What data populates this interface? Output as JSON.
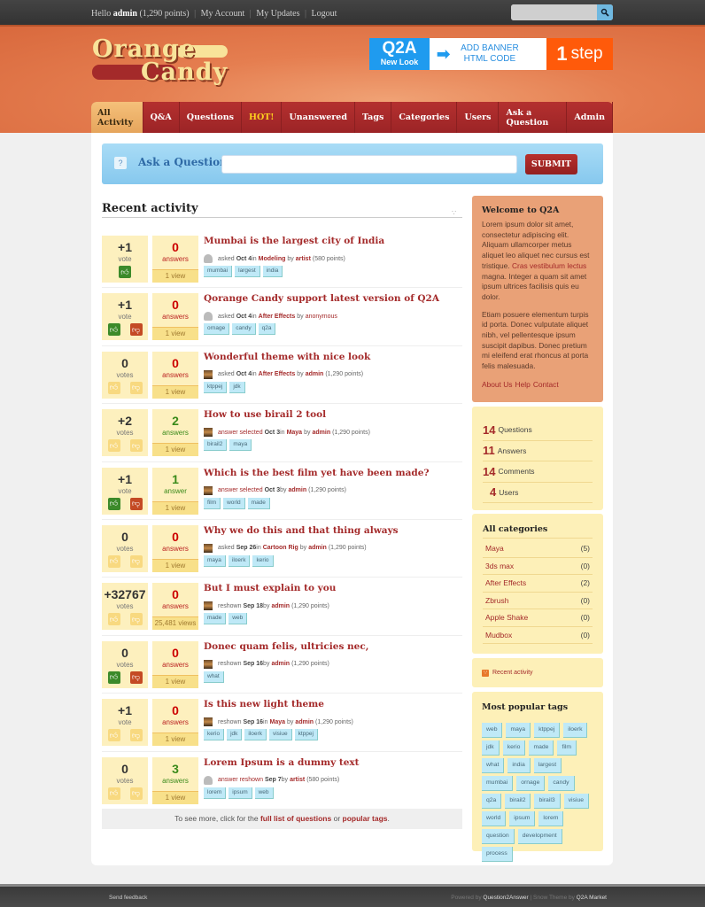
{
  "topbar": {
    "greeting": "Hello",
    "username": "admin",
    "points": "(1,290 points)",
    "links": [
      "My Account",
      "My Updates",
      "Logout"
    ],
    "search_placeholder": ""
  },
  "logo": {
    "line1": "Orange",
    "line2": "Candy"
  },
  "banner": {
    "brand": "Q2A",
    "sub": "New Look",
    "cta_line1": "ADD BANNER",
    "cta_line2": "HTML CODE",
    "step_num": "1",
    "step_label": "step"
  },
  "nav": {
    "tabs": [
      {
        "label": "All Activity",
        "active": true
      },
      {
        "label": "Q&A"
      },
      {
        "label": "Questions"
      },
      {
        "label": "HOT!",
        "hot": true
      },
      {
        "label": "Unanswered"
      },
      {
        "label": "Tags"
      },
      {
        "label": "Categories"
      },
      {
        "label": "Users"
      },
      {
        "label": "Ask a Question"
      },
      {
        "label": "Admin"
      }
    ]
  },
  "ask": {
    "label": "Ask a Question",
    "input_value": "",
    "submit": "SUBMIT"
  },
  "recent": {
    "title": "Recent activity",
    "questions": [
      {
        "votes": "+1",
        "votes_label": "vote",
        "answers": "0",
        "answers_label": "answers",
        "views": "1 view",
        "title": "Mumbai is the largest city of India",
        "avatar": "person",
        "what": "asked",
        "when": "Oct 4",
        "in": "in",
        "category": "Modeling",
        "by": "by",
        "who": "artist",
        "who_points": "(580 points)",
        "tags": [
          "mumbai",
          "largest",
          "india"
        ],
        "up_on": true,
        "down_on": false,
        "show_down": false,
        "answers_green": false
      },
      {
        "votes": "+1",
        "votes_label": "vote",
        "answers": "0",
        "answers_label": "answers",
        "views": "1 view",
        "title": "Qorange Candy support latest version of Q2A",
        "avatar": "person",
        "what": "asked",
        "when": "Oct 4",
        "in": "in",
        "category": "After Effects",
        "by": "by",
        "who": "anonymous",
        "who_points": "",
        "tags": [
          "ornage",
          "candy",
          "q2a"
        ],
        "up_on": true,
        "down_on": true,
        "show_down": true,
        "answers_green": false
      },
      {
        "votes": "0",
        "votes_label": "votes",
        "answers": "0",
        "answers_label": "answers",
        "views": "1 view",
        "title": "Wonderful theme with nice look",
        "avatar": "photo",
        "what": "asked",
        "when": "Oct 4",
        "in": "in",
        "category": "After Effects",
        "by": "by",
        "who": "admin",
        "who_points": "(1,290 points)",
        "tags": [
          "ktppej",
          "jdk"
        ],
        "up_on": false,
        "down_on": false,
        "show_down": true,
        "answers_green": false
      },
      {
        "votes": "+2",
        "votes_label": "votes",
        "answers": "2",
        "answers_label": "answers",
        "views": "1 view",
        "title": "How to use birail 2 tool",
        "avatar": "photo",
        "what": "answer selected",
        "when": "Oct 3",
        "in": "in",
        "category": "Maya",
        "by": "by",
        "who": "admin",
        "who_points": "(1,290 points)",
        "tags": [
          "birail2",
          "maya"
        ],
        "up_on": false,
        "down_on": false,
        "show_down": true,
        "answers_green": true
      },
      {
        "votes": "+1",
        "votes_label": "vote",
        "answers": "1",
        "answers_label": "answer",
        "views": "1 view",
        "title": "Which is the best film yet have been made?",
        "avatar": "photo",
        "what": "answer selected",
        "when": "Oct 3",
        "in": "",
        "category": "",
        "by": "by",
        "who": "admin",
        "who_points": "(1,290 points)",
        "tags": [
          "film",
          "world",
          "made"
        ],
        "up_on": true,
        "down_on": true,
        "show_down": true,
        "answers_green": true
      },
      {
        "votes": "0",
        "votes_label": "votes",
        "answers": "0",
        "answers_label": "answers",
        "views": "1 view",
        "title": "Why we do this and that thing always",
        "avatar": "photo",
        "what": "asked",
        "when": "Sep 26",
        "in": "in",
        "category": "Cartoon Rig",
        "by": "by",
        "who": "admin",
        "who_points": "(1,290 points)",
        "tags": [
          "maya",
          "iloerk",
          "kerio"
        ],
        "up_on": false,
        "down_on": false,
        "show_down": true,
        "answers_green": false
      },
      {
        "votes": "+32767",
        "votes_label": "votes",
        "answers": "0",
        "answers_label": "answers",
        "views": "25,481 views",
        "title": "But I must explain to you",
        "avatar": "photo",
        "what": "reshown",
        "when": "Sep 18",
        "in": "",
        "category": "",
        "by": "by",
        "who": "admin",
        "who_points": "(1,290 points)",
        "tags": [
          "made",
          "web"
        ],
        "up_on": false,
        "down_on": false,
        "show_down": true,
        "answers_green": false
      },
      {
        "votes": "0",
        "votes_label": "votes",
        "answers": "0",
        "answers_label": "answers",
        "views": "1 view",
        "title": "Donec quam felis, ultricies nec,",
        "avatar": "photo",
        "what": "reshown",
        "when": "Sep 16",
        "in": "",
        "category": "",
        "by": "by",
        "who": "admin",
        "who_points": "(1,290 points)",
        "tags": [
          "what"
        ],
        "up_on": true,
        "down_on": true,
        "show_down": true,
        "answers_green": false
      },
      {
        "votes": "+1",
        "votes_label": "vote",
        "answers": "0",
        "answers_label": "answers",
        "views": "1 view",
        "title": "Is this new light theme",
        "avatar": "photo",
        "what": "reshown",
        "when": "Sep 16",
        "in": "in",
        "category": "Maya",
        "by": "by",
        "who": "admin",
        "who_points": "(1,290 points)",
        "tags": [
          "kerio",
          "jdk",
          "iloerk",
          "visiue",
          "ktppej"
        ],
        "up_on": false,
        "down_on": false,
        "show_down": true,
        "answers_green": false
      },
      {
        "votes": "0",
        "votes_label": "votes",
        "answers": "3",
        "answers_label": "answers",
        "views": "1 view",
        "title": "Lorem Ipsum is a dummy text",
        "avatar": "person",
        "what": "answer reshown",
        "when": "Sep 7",
        "in": "",
        "category": "",
        "by": "by",
        "who": "artist",
        "who_points": "(580 points)",
        "tags": [
          "lorem",
          "ipsum",
          "web"
        ],
        "up_on": false,
        "down_on": false,
        "show_down": true,
        "answers_green": true
      }
    ],
    "more_prefix": "To see more, click for the",
    "more_link1": "full list of questions",
    "more_mid": "or",
    "more_link2": "popular tags",
    "more_suffix": "."
  },
  "sidebar": {
    "welcome": {
      "title": "Welcome to Q2A",
      "p1_a": "Lorem ipsum dolor sit amet, consectetur adipiscing elit. Aliquam ullamcorper metus aliquet leo aliquet nec cursus est tristique.",
      "p1_link": "Cras vestibulum lectus",
      "p1_b": "magna. Integer a quam sit amet ipsum ultrices facilisis quis eu dolor.",
      "p2": "Etiam posuere elementum turpis id porta. Donec vulputate aliquet nibh, vel pellentesque ipsum suscipit dapibus. Donec pretium mi eleifend erat rhoncus at porta felis malesuada.",
      "links": [
        "About Us",
        "Help",
        "Contact"
      ]
    },
    "stats": [
      {
        "count": "14",
        "label": "Questions"
      },
      {
        "count": "11",
        "label": "Answers"
      },
      {
        "count": "14",
        "label": "Comments"
      },
      {
        "count": "4",
        "label": "Users"
      }
    ],
    "categories": {
      "title": "All categories",
      "items": [
        {
          "name": "Maya",
          "count": "(5)"
        },
        {
          "name": "3ds max",
          "count": "(0)"
        },
        {
          "name": "After Effects",
          "count": "(2)"
        },
        {
          "name": "Zbrush",
          "count": "(0)"
        },
        {
          "name": "Apple Shake",
          "count": "(0)"
        },
        {
          "name": "Mudbox",
          "count": "(0)"
        }
      ]
    },
    "feed": {
      "label": "Recent activity"
    },
    "popular_tags": {
      "title": "Most popular tags",
      "tags": [
        "web",
        "maya",
        "ktppej",
        "iloerk",
        "jdk",
        "kerio",
        "made",
        "film",
        "what",
        "india",
        "largest",
        "mumbai",
        "ornage",
        "candy",
        "q2a",
        "birail2",
        "birail3",
        "visiue",
        "world",
        "ipsum",
        "lorem",
        "question",
        "development",
        "process"
      ]
    }
  },
  "footer": {
    "feedback": "Send feedback",
    "powered_prefix": "Powered by",
    "powered_link": "Question2Answer",
    "theme_prefix": "| Snow Theme by",
    "theme_link": "Q2A Market"
  },
  "colors": {
    "accent": "#a42a2a",
    "header": "#e57e50",
    "panel": "#fdf0b8",
    "tag": "#bfe9f7"
  }
}
